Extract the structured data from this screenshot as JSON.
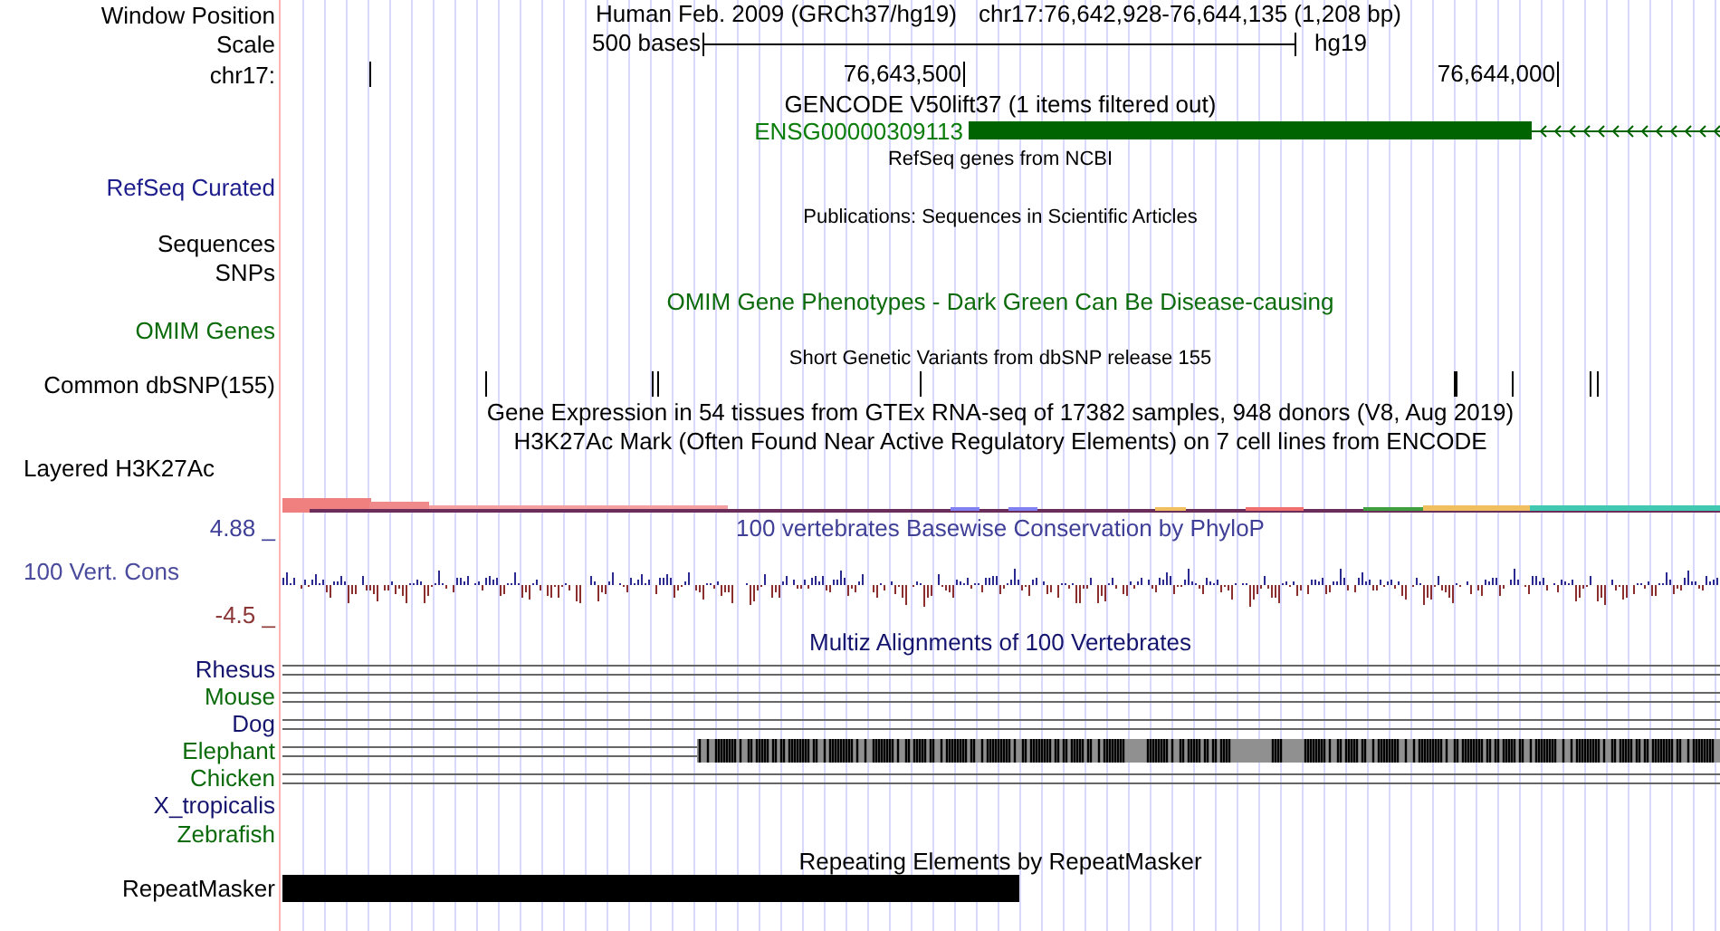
{
  "header": {
    "label": "Window Position",
    "assembly": "Human Feb. 2009 (GRCh37/hg19)",
    "position": "chr17:76,642,928-76,644,135 (1,208 bp)"
  },
  "scale": {
    "label": "Scale",
    "length": "500 bases",
    "assembly": "hg19"
  },
  "ruler": {
    "label": "chr17:",
    "ticks": [
      "76,643,500",
      "76,644,000"
    ]
  },
  "tracks": [
    {
      "kind": "gene",
      "title": {
        "text": "GENCODE V50lift37 (1 items filtered out)"
      },
      "item": "ENSG00000309113"
    },
    {
      "kind": "plain",
      "title": {
        "text": "RefSeq genes from NCBI"
      },
      "label": {
        "text": "RefSeq Curated",
        "color": "#1c1c8c"
      }
    },
    {
      "kind": "plain",
      "title": {
        "text": "Publications: Sequences in Scientific Articles"
      },
      "label": {
        "text": "Sequences"
      }
    },
    {
      "kind": "plain",
      "label": {
        "text": "SNPs"
      }
    },
    {
      "kind": "plain",
      "title": {
        "text": "OMIM Gene Phenotypes - Dark Green Can Be Disease-causing",
        "color": "#0b6b0b"
      },
      "label": {
        "text": "OMIM Genes",
        "color": "#0b6b0b"
      }
    },
    {
      "kind": "snp",
      "title": {
        "text": "Short Genetic Variants from dbSNP release 155"
      },
      "label": {
        "text": "Common dbSNP(155)"
      }
    },
    {
      "kind": "plain",
      "title": {
        "text": "Gene Expression in 54 tissues from GTEx RNA-seq of 17382 samples, 948 donors (V8, Aug 2019)"
      }
    },
    {
      "kind": "layered",
      "title": {
        "text": "H3K27Ac Mark (Often Found Near Active Regulatory Elements) on 7 cell lines from ENCODE"
      },
      "label": {
        "text": "Layered H3K27Ac"
      }
    },
    {
      "kind": "wiggle",
      "title": {
        "text": "100 vertebrates Basewise Conservation by PhyloP",
        "color": "#3f3f98"
      },
      "label": {
        "text": "100 Vert. Cons",
        "color": "#4b4b9e"
      },
      "max": "4.88 _",
      "min": "-4.5 _"
    },
    {
      "kind": "multiz",
      "title": {
        "text": "Multiz Alignments of 100 Vertebrates",
        "color": "#14146e"
      },
      "species": [
        {
          "name": "Rhesus",
          "color": "#14146e",
          "kind": "line"
        },
        {
          "name": "Mouse",
          "color": "#0b6b0b",
          "kind": "line"
        },
        {
          "name": "Dog",
          "color": "#14146e",
          "kind": "line"
        },
        {
          "name": "Elephant",
          "color": "#0b6b0b",
          "kind": "blocks"
        },
        {
          "name": "Chicken",
          "color": "#0b6b0b",
          "kind": "line"
        },
        {
          "name": "X_tropicalis",
          "color": "#14146e",
          "kind": "none"
        },
        {
          "name": "Zebrafish",
          "color": "#0b6b0b",
          "kind": "none"
        }
      ]
    },
    {
      "kind": "repeat",
      "title": {
        "text": "Repeating Elements by RepeatMasker"
      },
      "label": {
        "text": "RepeatMasker"
      }
    }
  ]
}
